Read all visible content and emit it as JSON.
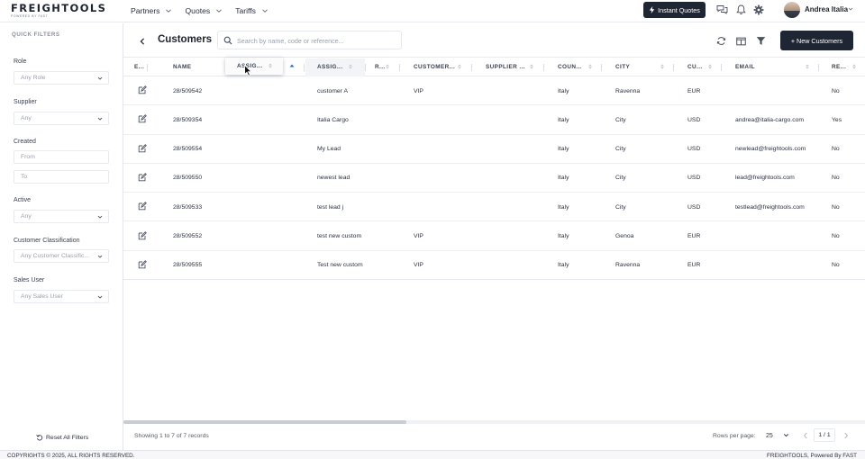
{
  "app": {
    "logo": "FREIGHTOOLS",
    "logo_sub": "POWERED BY FAST"
  },
  "nav": {
    "items": [
      {
        "label": "Partners"
      },
      {
        "label": "Quotes"
      },
      {
        "label": "Tariffs"
      }
    ],
    "instant_quotes": "Instant Quotes",
    "user_name": "Andrea Italia",
    "icons": [
      "chat-icon",
      "bell-icon",
      "gear-icon"
    ]
  },
  "sidebar": {
    "title": "QUICK FILTERS",
    "filters": {
      "role": {
        "label": "Role",
        "value": "Any Role"
      },
      "supplier": {
        "label": "Supplier",
        "value": "Any"
      },
      "created": {
        "label": "Created",
        "from": "From",
        "to": "To"
      },
      "active": {
        "label": "Active",
        "value": "Any"
      },
      "classification": {
        "label": "Customer Classification",
        "value": "Any Customer Classific..."
      },
      "sales_user": {
        "label": "Sales User",
        "value": "Any Sales User"
      }
    },
    "reset": "Reset All Filters"
  },
  "main": {
    "title": "Customers",
    "search_placeholder": "Search by name, code or reference...",
    "new_button": "+ New Customers",
    "dragging_column": "ASSIG...",
    "columns": [
      "E...",
      "NAME",
      "ASSIG...",
      "R...",
      "CUSTOMER...",
      "SUPPLIER ...",
      "COUN...",
      "CITY",
      "CU...",
      "EMAIL",
      "RE..."
    ],
    "rows": [
      {
        "code": "28/509542",
        "assigned": "customer A",
        "class": "VIP",
        "country": "Italy",
        "city": "Ravenna",
        "currency": "EUR",
        "email": "",
        "re": "No"
      },
      {
        "code": "28/509354",
        "assigned": "Italia Cargo",
        "class": "",
        "country": "Italy",
        "city": "City",
        "currency": "USD",
        "email": "andrea@italia-cargo.com",
        "re": "Yes"
      },
      {
        "code": "28/509554",
        "assigned": "My Lead",
        "class": "",
        "country": "Italy",
        "city": "City",
        "currency": "USD",
        "email": "newlead@freightools.com",
        "re": "No"
      },
      {
        "code": "28/509550",
        "assigned": "newest lead",
        "class": "",
        "country": "Italy",
        "city": "City",
        "currency": "USD",
        "email": "lead@freightools.com",
        "re": "No"
      },
      {
        "code": "28/509533",
        "assigned": "test lead j",
        "class": "",
        "country": "Italy",
        "city": "City",
        "currency": "USD",
        "email": "testlead@freightools.com",
        "re": "No"
      },
      {
        "code": "28/509552",
        "assigned": "test new custom",
        "class": "VIP",
        "country": "Italy",
        "city": "Genoa",
        "currency": "EUR",
        "email": "",
        "re": "No"
      },
      {
        "code": "28/509555",
        "assigned": "Test new custom",
        "class": "VIP",
        "country": "Italy",
        "city": "Ravenna",
        "currency": "EUR",
        "email": "",
        "re": "No"
      }
    ],
    "showing": "Showing 1 to 7 of 7 records",
    "rows_per_page_label": "Rows per page:",
    "rows_per_page": "25",
    "page": "1 / 1"
  },
  "footer": {
    "copyright": "COPYRIGHTS © 2025, ALL RIGHTS RESERVED.",
    "powered": "FREIGHTOOLS, Powered By FAST"
  }
}
